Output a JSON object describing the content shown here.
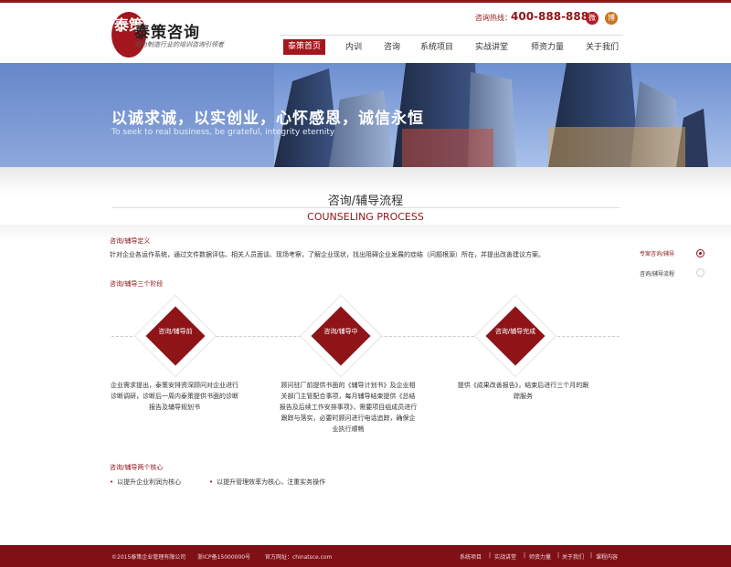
{
  "brand": {
    "name": "泰策咨询",
    "slogan": "成为制造行业的培训咨询引领者",
    "logo_glyphs": "泰策"
  },
  "hotline": {
    "label": "咨询热线：",
    "number": "400-888-8888"
  },
  "social": {
    "wechat": "微",
    "weibo": "博"
  },
  "nav": {
    "items": [
      "泰策首页",
      "内训",
      "咨询",
      "系统项目",
      "实战讲堂",
      "师资力量",
      "关于我们"
    ],
    "active": "泰策首页"
  },
  "banner": {
    "title": "以诚求诚，以实创业，心怀感恩，诚信永恒",
    "subtitle": "To seek to real business, be grateful, integrity eternity"
  },
  "section": {
    "title": "咨询/辅导流程",
    "subtitle": "COUNSELING PROCESS"
  },
  "definition": {
    "heading": "咨询/辅导定义",
    "text": "针对企业各运作系统，通过文件数据评估、相关人员面谈、现场考察，了解企业现状，找出阻碍企业发展的症结（问题根源）所在，并提出改善建议方案。"
  },
  "stages": {
    "heading": "咨询/辅导三个阶段",
    "items": [
      {
        "label": "咨询/辅导前",
        "text": "企业需求提出，泰策安排资深顾问对企业进行诊断调研，诊断后一周内泰策提供书面的诊断报告及辅导规划书"
      },
      {
        "label": "咨询/辅导中",
        "text": "顾问驻厂前提供书面的《辅导计划书》及企业相关部门主管配合事项，每月辅导结束提供《总结报告及后续工作安排事项》，需要项目组成员进行跟踪与落实，必要时顾问进行电话追踪，确保企业执行顺畅"
      },
      {
        "label": "咨询/辅导完成",
        "text": "提供《成果改善报告》，结束后进行三个月的跟踪服务"
      }
    ]
  },
  "cores": {
    "heading": "咨询/辅导两个核心",
    "items": [
      "以提升企业利润为核心",
      "以提升管理效率为核心，注重实务操作"
    ]
  },
  "sidenav": {
    "items": [
      "专案咨询/辅导",
      "咨询/辅导流程"
    ],
    "active": "专案咨询/辅导"
  },
  "footer": {
    "copyright": "©2015泰策企业管理有限公司",
    "icp": "浙ICP备15000000号",
    "site": "官方网址：chinatsce.com",
    "links": [
      "系统项目",
      "实战讲堂",
      "师资力量",
      "关于我们",
      "课程内容"
    ]
  },
  "colors": {
    "brand": "#8f1418",
    "banner": "#4a66a8",
    "footer": "#7f1016"
  }
}
